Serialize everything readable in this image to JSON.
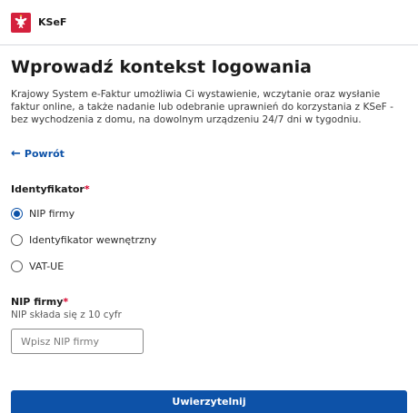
{
  "header": {
    "brand": "KSeF",
    "logo_icon": "polish-eagle-emblem-icon"
  },
  "main": {
    "title": "Wprowadź kontekst logowania",
    "description": "Krajowy System e-Faktur umożliwia Ci wystawienie, wczytanie oraz wysłanie faktur online, a także nadanie lub odebranie uprawnień do korzystania z KSeF - bez wychodzenia z domu, na dowolnym urządzeniu 24/7 dni w tygodniu.",
    "back_label": "Powrót",
    "back_icon": "arrow-left-icon"
  },
  "identifier": {
    "label": "Identyfikator",
    "required_mark": "*",
    "options": [
      {
        "label": "NIP firmy",
        "selected": true
      },
      {
        "label": "Identyfikator wewnętrzny",
        "selected": false
      },
      {
        "label": "VAT-UE",
        "selected": false
      }
    ]
  },
  "nip": {
    "label": "NIP firmy",
    "required_mark": "*",
    "hint": "NIP składa się z 10 cyfr",
    "placeholder": "Wpisz NIP firmy",
    "value": ""
  },
  "actions": {
    "submit_label": "Uwierzytelnij"
  },
  "colors": {
    "accent": "#0d52a8",
    "required": "#d8002b",
    "emblem_red": "#d4213d"
  }
}
